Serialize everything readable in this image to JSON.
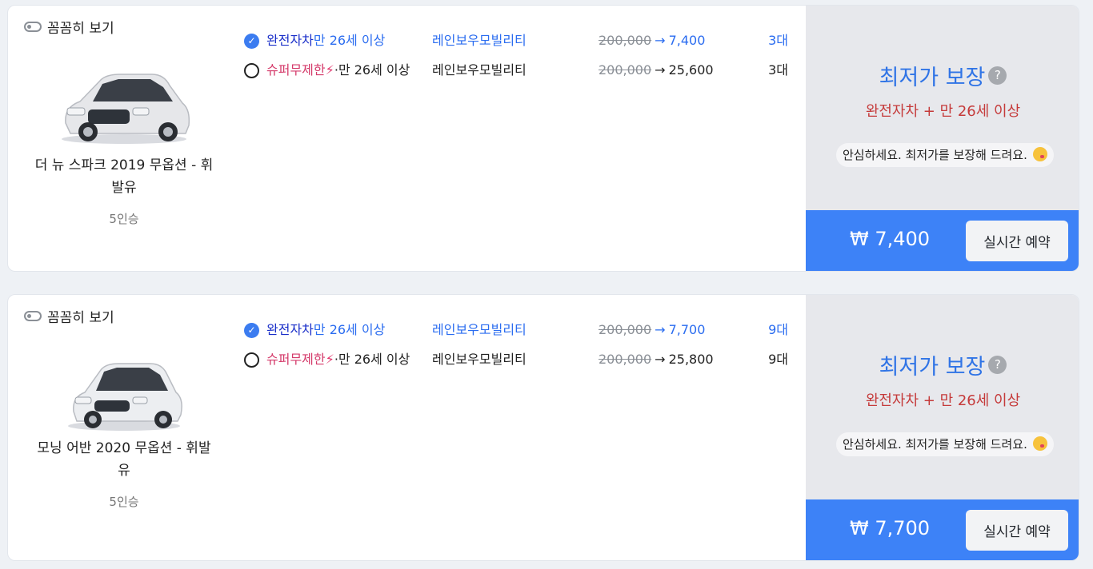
{
  "cards": [
    {
      "toggle_label": "꼼꼼히 보기",
      "car_name": "더 뉴 스파크 2019 무옵션 - 휘발유",
      "seats": "5인승",
      "options": [
        {
          "selected": true,
          "insurance": "완전자차",
          "age": "만 26세 이상",
          "company": "레인보우모빌리티",
          "old_price": "200,000",
          "new_price": "7,400",
          "count": "3대"
        },
        {
          "selected": false,
          "insurance": "슈퍼무제한",
          "age": "만 26세 이상",
          "company": "레인보우모빌리티",
          "old_price": "200,000",
          "new_price": "25,600",
          "count": "3대"
        }
      ],
      "guarantee_title": "최저가 보장",
      "guarantee_sub": "완전자차 + 만 26세 이상",
      "reassure": "안심하세요. 최저가를 보장해 드려요.",
      "pay_price": "₩ 7,400",
      "book_label": "실시간 예약"
    },
    {
      "toggle_label": "꼼꼼히 보기",
      "car_name": "모닝 어반 2020 무옵션 - 휘발유",
      "seats": "5인승",
      "options": [
        {
          "selected": true,
          "insurance": "완전자차",
          "age": "만 26세 이상",
          "company": "레인보우모빌리티",
          "old_price": "200,000",
          "new_price": "7,700",
          "count": "9대"
        },
        {
          "selected": false,
          "insurance": "슈퍼무제한",
          "age": "만 26세 이상",
          "company": "레인보우모빌리티",
          "old_price": "200,000",
          "new_price": "25,800",
          "count": "9대"
        }
      ],
      "guarantee_title": "최저가 보장",
      "guarantee_sub": "완전자차 + 만 26세 이상",
      "reassure": "안심하세요. 최저가를 보장해 드려요.",
      "pay_price": "₩ 7,700",
      "book_label": "실시간 예약"
    }
  ],
  "icons": {
    "check": "check-icon",
    "lightning": "lightning-icon",
    "help": "help-icon",
    "emoji": "kissing-face-icon",
    "toggle": "toggle-icon"
  },
  "colors": {
    "accent_blue": "#3d82f7",
    "full_coverage": "#1a2fc9",
    "super_unlimited": "#d43a6a",
    "guarantee_red": "#c53a3a"
  }
}
